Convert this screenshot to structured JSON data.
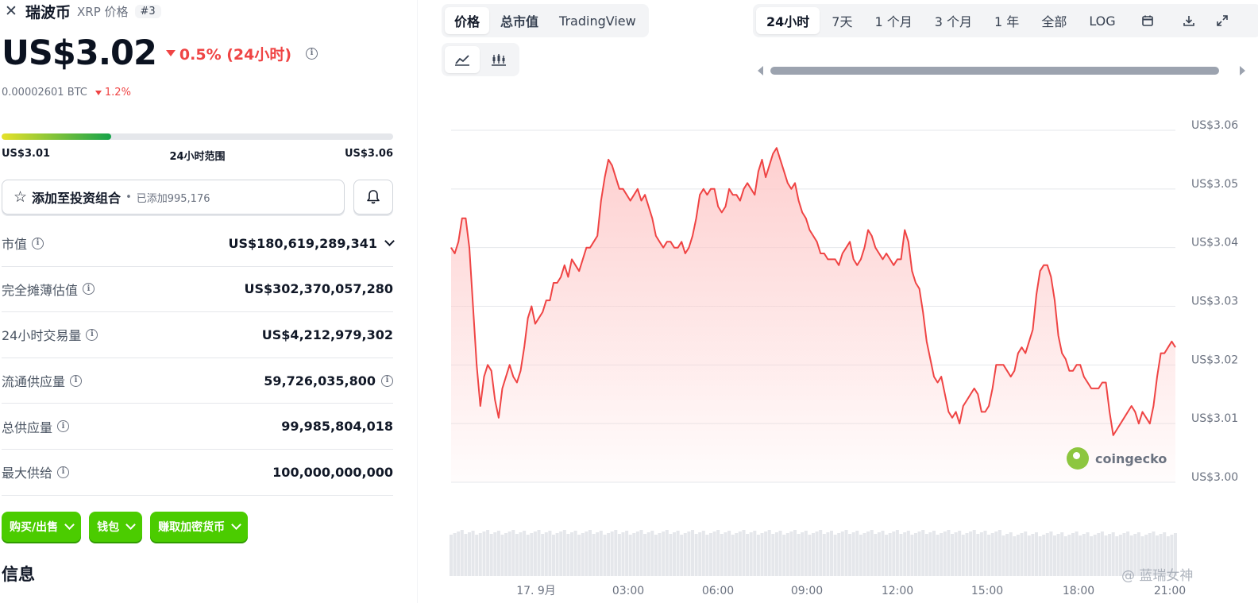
{
  "header": {
    "close_icon": "close-icon",
    "coin_name": "瑞波币",
    "coin_subtitle": "XRP 价格",
    "rank": "#3"
  },
  "price": {
    "value": "US$3.02",
    "change_24h": "0.5% (24小时)",
    "change_direction": "down",
    "btc_value": "0.00002601 BTC",
    "btc_change": "1.2%"
  },
  "range_24h": {
    "low": "US$3.01",
    "label": "24小时范围",
    "high": "US$3.06",
    "position_fraction": 0.28
  },
  "portfolio": {
    "label": "添加至投资组合",
    "added": "已添加995,176"
  },
  "stats": [
    {
      "label": "市值",
      "value": "US$180,619,289,341",
      "has_chevron": true,
      "value_info": false
    },
    {
      "label": "完全摊薄估值",
      "value": "US$302,370,057,280",
      "has_chevron": false,
      "value_info": false
    },
    {
      "label": "24小时交易量",
      "value": "US$4,212,979,302",
      "has_chevron": false,
      "value_info": false
    },
    {
      "label": "流通供应量",
      "value": "59,726,035,800",
      "has_chevron": false,
      "value_info": true
    },
    {
      "label": "总供应量",
      "value": "99,985,804,018",
      "has_chevron": false,
      "value_info": false
    },
    {
      "label": "最大供给",
      "value": "100,000,000,000",
      "has_chevron": false,
      "value_info": false
    }
  ],
  "actions": [
    {
      "label": "购买/出售"
    },
    {
      "label": "钱包"
    },
    {
      "label": "赚取加密货币"
    }
  ],
  "section_heading": "信息",
  "chart_tabs": [
    {
      "label": "价格",
      "active": true
    },
    {
      "label": "总市值",
      "active": false
    },
    {
      "label": "TradingView",
      "active": false
    }
  ],
  "chart_type_icons": [
    "line-chart-icon",
    "candlestick-chart-icon"
  ],
  "range_tabs": [
    {
      "label": "24小时",
      "active": true
    },
    {
      "label": "7天",
      "active": false
    },
    {
      "label": "1 个月",
      "active": false
    },
    {
      "label": "3 个月",
      "active": false
    },
    {
      "label": "1 年",
      "active": false
    },
    {
      "label": "全部",
      "active": false
    },
    {
      "label": "LOG",
      "active": false
    }
  ],
  "toolbar_icons": [
    "calendar-icon",
    "download-icon",
    "fullscreen-icon"
  ],
  "watermark": {
    "brand": "coingecko",
    "corner_text": "@ 蓝瑞女神"
  },
  "colors": {
    "line": "#ef4444",
    "area": "#fecaca",
    "accent_green": "#4bcc00",
    "negative": "#ef4444"
  },
  "chart_data": {
    "type": "area",
    "y_ticks": [
      "US$3.06",
      "US$3.05",
      "US$3.04",
      "US$3.03",
      "US$3.02",
      "US$3.01",
      "US$3.00"
    ],
    "ylim": [
      3.0,
      3.06
    ],
    "x_ticks": [
      "17. 9月",
      "03:00",
      "06:00",
      "09:00",
      "12:00",
      "15:00",
      "18:00",
      "21:00"
    ],
    "series": [
      {
        "values": [
          3.04,
          3.039,
          3.041,
          3.045,
          3.045,
          3.04,
          3.03,
          3.02,
          3.013,
          3.018,
          3.02,
          3.019,
          3.014,
          3.011,
          3.016,
          3.018,
          3.02,
          3.018,
          3.017,
          3.019,
          3.023,
          3.028,
          3.03,
          3.027,
          3.028,
          3.029,
          3.031,
          3.031,
          3.034,
          3.034,
          3.035,
          3.037,
          3.035,
          3.038,
          3.037,
          3.036,
          3.038,
          3.04,
          3.04,
          3.041,
          3.042,
          3.048,
          3.052,
          3.055,
          3.054,
          3.052,
          3.05,
          3.05,
          3.049,
          3.048,
          3.049,
          3.05,
          3.048,
          3.049,
          3.047,
          3.045,
          3.042,
          3.041,
          3.04,
          3.041,
          3.041,
          3.04,
          3.04,
          3.041,
          3.039,
          3.04,
          3.042,
          3.045,
          3.049,
          3.05,
          3.049,
          3.05,
          3.05,
          3.047,
          3.046,
          3.047,
          3.05,
          3.049,
          3.049,
          3.048,
          3.05,
          3.051,
          3.05,
          3.049,
          3.053,
          3.055,
          3.052,
          3.054,
          3.056,
          3.057,
          3.055,
          3.053,
          3.051,
          3.05,
          3.051,
          3.048,
          3.046,
          3.045,
          3.043,
          3.042,
          3.041,
          3.039,
          3.039,
          3.038,
          3.038,
          3.038,
          3.037,
          3.039,
          3.04,
          3.041,
          3.038,
          3.037,
          3.038,
          3.04,
          3.043,
          3.042,
          3.04,
          3.039,
          3.038,
          3.039,
          3.038,
          3.037,
          3.038,
          3.038,
          3.043,
          3.041,
          3.036,
          3.034,
          3.033,
          3.029,
          3.024,
          3.021,
          3.018,
          3.017,
          3.018,
          3.015,
          3.012,
          3.011,
          3.012,
          3.01,
          3.013,
          3.014,
          3.015,
          3.016,
          3.015,
          3.012,
          3.012,
          3.013,
          3.016,
          3.02,
          3.02,
          3.02,
          3.019,
          3.018,
          3.019,
          3.022,
          3.023,
          3.022,
          3.024,
          3.026,
          3.032,
          3.036,
          3.037,
          3.037,
          3.035,
          3.031,
          3.025,
          3.022,
          3.021,
          3.019,
          3.019,
          3.02,
          3.02,
          3.018,
          3.017,
          3.016,
          3.016,
          3.016,
          3.017,
          3.017,
          3.012,
          3.008,
          3.009,
          3.01,
          3.011,
          3.012,
          3.013,
          3.012,
          3.01,
          3.012,
          3.011,
          3.01,
          3.013,
          3.018,
          3.022,
          3.022,
          3.023,
          3.024,
          3.023
        ]
      }
    ],
    "volume_bars": true,
    "grid": true
  }
}
